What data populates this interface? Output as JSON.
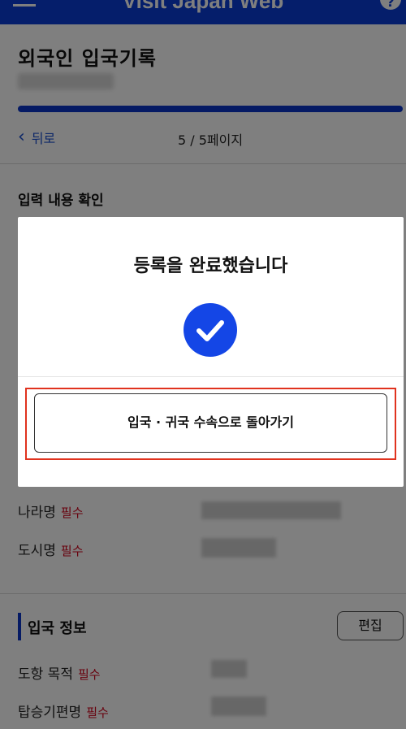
{
  "topbar": {
    "brand": "Visit Japan Web",
    "help_symbol": "?"
  },
  "page": {
    "title": "외국인 입국기록",
    "back_label": "뒤로",
    "pager": "5 / 5페이지",
    "section_heading": "입력 내용 확인"
  },
  "address_fields": [
    {
      "label": "나라명",
      "required": "필수"
    },
    {
      "label": "도시명",
      "required": "필수"
    }
  ],
  "entry_info": {
    "title": "입국 정보",
    "edit_label": "편집",
    "fields": [
      {
        "label": "도항 목적",
        "required": "필수"
      },
      {
        "label": "탑승기편명",
        "required": "필수"
      }
    ]
  },
  "modal": {
    "title": "등록을 완료했습니다",
    "button_label": "입국 · 귀국 수속으로 돌아가기"
  },
  "colors": {
    "brand_blue": "#0a3cd6",
    "check_blue": "#1446e6",
    "required_red": "#d0021b",
    "highlight_red": "#e0321e"
  },
  "icons": [
    "hamburger-icon",
    "help-icon",
    "chevron-left-icon",
    "check-circle-icon"
  ]
}
